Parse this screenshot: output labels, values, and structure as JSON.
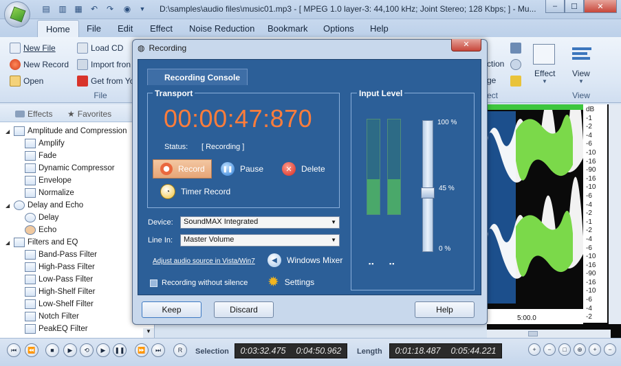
{
  "window": {
    "title": "D:\\samples\\audio files\\music01.mp3 - [ MPEG 1.0 layer-3: 44,100 kHz; Joint Stereo; 128 Kbps;  ] - Mu...",
    "minimize": "‒",
    "maximize": "☐",
    "close": "✕"
  },
  "ribbon": {
    "tabs": [
      "Home",
      "File",
      "Edit",
      "Effect",
      "Noise Reduction",
      "Bookmark",
      "Options",
      "Help"
    ],
    "file_group": {
      "label": "File",
      "items": [
        "New File",
        "New Record",
        "Open",
        "Load CD",
        "Import fron",
        "Get from Yo"
      ]
    },
    "partial_items": [
      "ction",
      "ge"
    ],
    "partial_group_label": "ect",
    "effect_label": "Effect",
    "view_label": "View",
    "view_group_label": "View"
  },
  "left_panel": {
    "tabs": [
      "Effects",
      "Favorites"
    ],
    "tree": [
      {
        "label": "Amplitude and Compression",
        "level": 0
      },
      {
        "label": "Amplify",
        "level": 1
      },
      {
        "label": "Fade",
        "level": 1
      },
      {
        "label": "Dynamic Compressor",
        "level": 1
      },
      {
        "label": "Envelope",
        "level": 1
      },
      {
        "label": "Normalize",
        "level": 1
      },
      {
        "label": "Delay and Echo",
        "level": 0
      },
      {
        "label": "Delay",
        "level": 1
      },
      {
        "label": "Echo",
        "level": 1
      },
      {
        "label": "Filters and EQ",
        "level": 0
      },
      {
        "label": "Band-Pass Filter",
        "level": 1
      },
      {
        "label": "High-Pass Filter",
        "level": 1
      },
      {
        "label": "Low-Pass Filter",
        "level": 1
      },
      {
        "label": "High-Shelf Filter",
        "level": 1
      },
      {
        "label": "Low-Shelf Filter",
        "level": 1
      },
      {
        "label": "Notch Filter",
        "level": 1
      },
      {
        "label": "PeakEQ Filter",
        "level": 1
      }
    ]
  },
  "waveform": {
    "db_label": "dB",
    "db_ticks_top": [
      "-1",
      "-2",
      "-4",
      "-6",
      "-10",
      "-16",
      "-90",
      "-16",
      "-10",
      "-6",
      "-4",
      "-2",
      "-1"
    ],
    "db_ticks_bottom": [
      "-1",
      "-2",
      "-4",
      "-6",
      "-10",
      "-16",
      "-90",
      "-16",
      "-10",
      "-6",
      "-4",
      "-2",
      "-1"
    ],
    "time_marker": "5:00.0"
  },
  "dialog": {
    "title": "Recording",
    "console_tab": "Recording Console",
    "transport_label": "Transport",
    "time": "00:00:47:870",
    "status_label": "Status:",
    "status_value": "[ Recording ]",
    "record": "Record",
    "pause": "Pause",
    "delete": "Delete",
    "timer_record": "Timer Record",
    "device_label": "Device:",
    "device_value": "SoundMAX Integrated",
    "linein_label": "Line In:",
    "linein_value": "Master Volume",
    "adjust_link": "Adjust audio source in Vista/Win7",
    "windows_mixer": "Windows Mixer",
    "without_silence": "Recording without silence",
    "settings": "Settings",
    "input_level_label": "Input Level",
    "level_100": "100 %",
    "level_45": "45 %",
    "level_0": "0 %",
    "slider_level_percent": 45,
    "keep": "Keep",
    "discard": "Discard",
    "help": "Help"
  },
  "statusbar": {
    "selection_label": "Selection",
    "selection_start": "0:03:32.475",
    "selection_end": "0:04:50.962",
    "length_label": "Length",
    "length_start": "0:01:18.487",
    "length_end": "0:05:44.221"
  },
  "colors": {
    "time_orange": "#ff7d3b",
    "console_blue": "#2c5f98",
    "wave_green": "#7bd94a"
  }
}
